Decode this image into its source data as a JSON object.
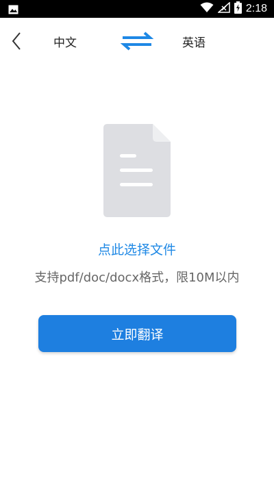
{
  "status_bar": {
    "time": "2:18",
    "icons": [
      "image-icon",
      "wifi-icon",
      "signal-icon",
      "battery-charging-icon"
    ]
  },
  "header": {
    "source_language": "中文",
    "target_language": "英语",
    "icons": {
      "back": "chevron-left-icon",
      "swap": "swap-arrows-icon"
    }
  },
  "upload": {
    "icon": "document-icon",
    "choose_file_label": "点此选择文件",
    "support_text": "支持pdf/doc/docx格式，限10M以内"
  },
  "actions": {
    "translate_label": "立即翻译"
  },
  "colors": {
    "accent": "#1e88e5",
    "button": "#1e7fe0",
    "document_icon": "#dddee2"
  }
}
